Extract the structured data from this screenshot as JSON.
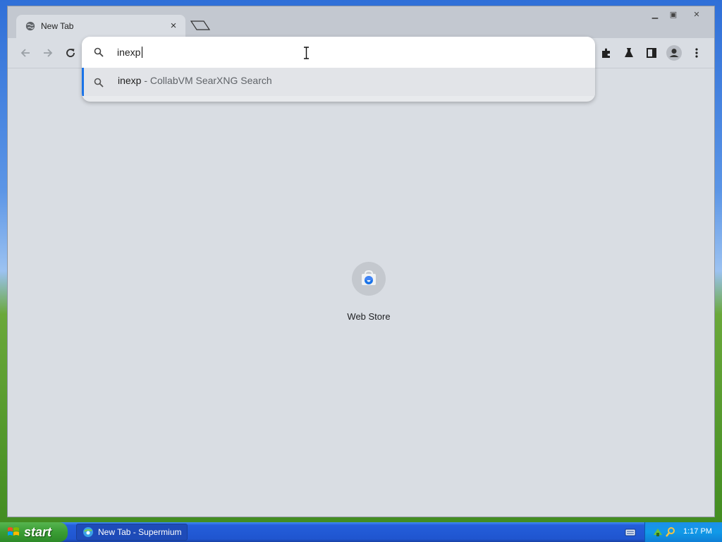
{
  "browser": {
    "tab": {
      "title": "New Tab",
      "close_glyph": "×"
    },
    "window_controls": {
      "minimize": "▁",
      "maximize": "▣",
      "close": "✕"
    }
  },
  "omnibox": {
    "value": "inexp",
    "suggestion": {
      "query": "inexp",
      "description": " - CollabVM SearXNG Search"
    }
  },
  "new_tab_page": {
    "shortcuts": [
      {
        "label": "Web Store",
        "icon": "web-store-icon"
      }
    ]
  },
  "taskbar": {
    "start_label": "start",
    "task_label": "New Tab - Supermium",
    "clock": "1:17 PM"
  },
  "colors": {
    "accent": "#1a73e8",
    "taskbar": "#245edb",
    "start_green": "#3a9d34"
  }
}
